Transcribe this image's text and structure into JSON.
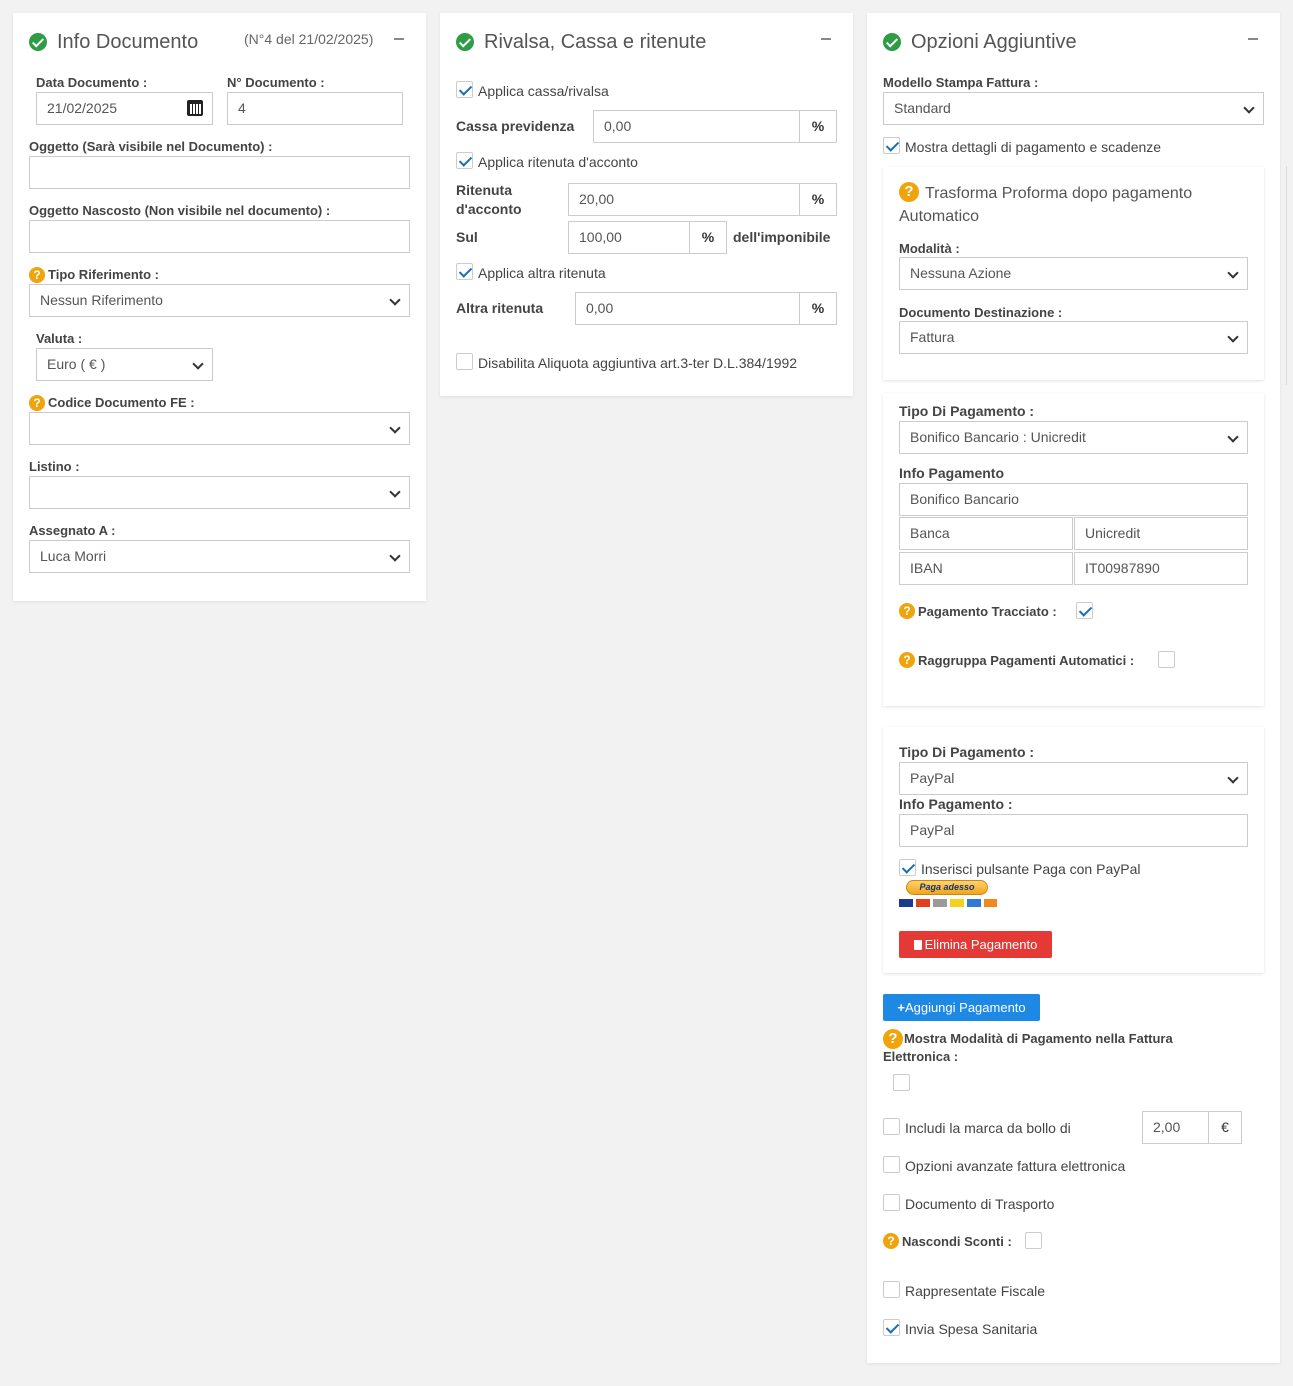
{
  "info": {
    "title": "Info Documento",
    "doc_ref": "(N°4 del 21/02/2025)",
    "data_label": "Data Documento :",
    "data_value": "21/02/2025",
    "num_label": "N° Documento :",
    "num_value": "4",
    "oggetto_label": "Oggetto (Sarà visibile nel Documento) :",
    "oggetto_value": "",
    "nascosto_label": "Oggetto Nascosto (Non visibile nel documento) :",
    "nascosto_value": "",
    "tiporif_label": "Tipo Riferimento :",
    "tiporif_value": "Nessun Riferimento",
    "valuta_label": "Valuta :",
    "valuta_value": "Euro ( € )",
    "codfe_label": "Codice Documento FE :",
    "codfe_value": "",
    "listino_label": "Listino :",
    "listino_value": "",
    "assegnato_label": "Assegnato A :",
    "assegnato_value": "Luca Morri"
  },
  "rivalsa": {
    "title": "Rivalsa, Cassa e ritenute",
    "applica_cassa": "Applica cassa/rivalsa",
    "cassa_label": "Cassa previdenza",
    "cassa_value": "0,00",
    "pct": "%",
    "applica_ritenuta": "Applica ritenuta d'acconto",
    "ritenuta_label": "Ritenuta d'acconto",
    "ritenuta_value": "20,00",
    "sul_label": "Sul",
    "sul_value": "100,00",
    "imponibile": "dell'imponibile",
    "applica_altra": "Applica altra ritenuta",
    "altra_label": "Altra ritenuta",
    "altra_value": "0,00",
    "disabilita": "Disabilita Aliquota aggiuntiva art.3-ter D.L.384/1992"
  },
  "opzioni": {
    "title": "Opzioni Aggiuntive",
    "modello_label": "Modello Stampa Fattura :",
    "modello_value": "Standard",
    "mostra_dettagli": "Mostra dettagli di pagamento e scadenze",
    "trasforma_title": "Trasforma Proforma dopo pagamento Automatico",
    "modalita_label": "Modalità :",
    "modalita_value": "Nessuna Azione",
    "destinazione_label": "Documento Destinazione :",
    "destinazione_value": "Fattura",
    "pag1": {
      "tipo_label": "Tipo Di Pagamento :",
      "tipo_value": "Bonifico Bancario : Unicredit",
      "info_label": "Info Pagamento",
      "info_value": "Bonifico Bancario",
      "banca_key": "Banca",
      "banca_value": "Unicredit",
      "iban_key": "IBAN",
      "iban_value": "IT00987890",
      "tracciato_label": "Pagamento Tracciato :",
      "raggruppa_label": "Raggruppa Pagamenti Automatici :"
    },
    "pag2": {
      "tipo_label": "Tipo Di Pagamento :",
      "tipo_value": "PayPal",
      "info_label": "Info Pagamento :",
      "info_value": "PayPal",
      "inserisci": "Inserisci pulsante Paga con PayPal",
      "paga_adesso": "Paga adesso",
      "elimina": "Elimina Pagamento"
    },
    "aggiungi": "Aggiungi Pagamento",
    "mostra_modalita": "Mostra Modalità di Pagamento nella Fattura Elettronica :",
    "marca_bollo": "Includi la marca da bollo di",
    "bollo_value": "2,00",
    "euro": "€",
    "opzioni_avanzate": "Opzioni avanzate fattura elettronica",
    "ddt": "Documento di Trasporto",
    "nascondi_sconti": "Nascondi Sconti :",
    "rappresentante": "Rappresentate Fiscale",
    "spesa_sanitaria": "Invia Spesa Sanitaria"
  },
  "colors": {
    "green": "#2e9c44",
    "orange": "#f0a30a",
    "blue": "#1e88e5",
    "red": "#e53935"
  }
}
